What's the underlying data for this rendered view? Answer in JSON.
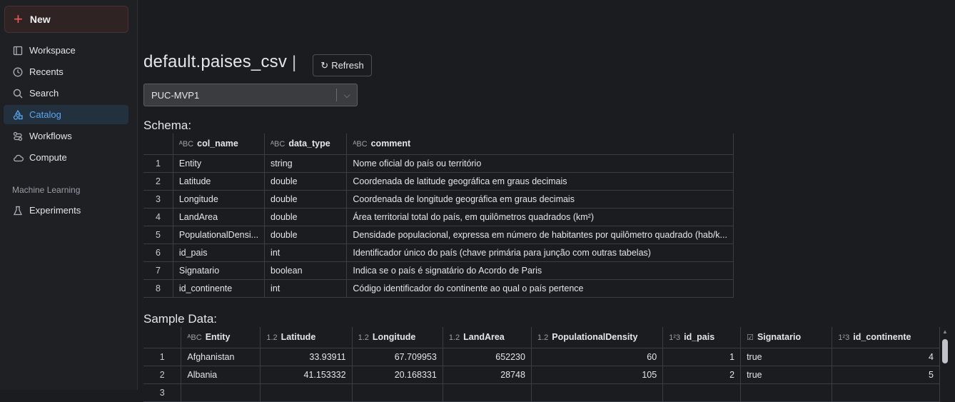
{
  "sidebar": {
    "new_label": "New",
    "items": [
      {
        "label": "Workspace",
        "icon": "workspace-icon"
      },
      {
        "label": "Recents",
        "icon": "clock-icon"
      },
      {
        "label": "Search",
        "icon": "search-icon"
      },
      {
        "label": "Catalog",
        "icon": "catalog-icon",
        "active": true
      },
      {
        "label": "Workflows",
        "icon": "workflows-icon"
      },
      {
        "label": "Compute",
        "icon": "cloud-icon"
      }
    ],
    "ml_section": "Machine Learning",
    "ml_items": [
      {
        "label": "Experiments",
        "icon": "flask-icon"
      }
    ]
  },
  "main": {
    "title": "default.paises_csv",
    "separator": "|",
    "refresh_label": "Refresh",
    "select_value": "PUC-MVP1",
    "schema_title": "Schema:",
    "schema_columns": [
      "col_name",
      "data_type",
      "comment"
    ],
    "schema_rows": [
      [
        "1",
        "Entity",
        "string",
        "Nome oficial do país ou território"
      ],
      [
        "2",
        "Latitude",
        "double",
        "Coordenada de latitude geográfica em graus decimais"
      ],
      [
        "3",
        "Longitude",
        "double",
        "Coordenada de longitude geográfica em graus decimais"
      ],
      [
        "4",
        "LandArea",
        "double",
        "Área territorial total do país, em quilômetros quadrados (km²)"
      ],
      [
        "5",
        "PopulationalDensi...",
        "double",
        "Densidade populacional, expressa em número de habitantes por quilômetro quadrado (hab/k..."
      ],
      [
        "6",
        "id_pais",
        "int",
        "Identificador único do país (chave primária para junção com outras tabelas)"
      ],
      [
        "7",
        "Signatario",
        "boolean",
        "Indica se o país é signatário do Acordo de Paris"
      ],
      [
        "8",
        "id_continente",
        "int",
        "Código identificador do continente ao qual o país pertence"
      ]
    ],
    "sample_title": "Sample Data:",
    "sample_columns": [
      {
        "type": "ABC",
        "name": "Entity"
      },
      {
        "type": "1.2",
        "name": "Latitude"
      },
      {
        "type": "1.2",
        "name": "Longitude"
      },
      {
        "type": "1.2",
        "name": "LandArea"
      },
      {
        "type": "1.2",
        "name": "PopulationalDensity"
      },
      {
        "type": "123",
        "name": "id_pais"
      },
      {
        "type": "check",
        "name": "Signatario"
      },
      {
        "type": "123",
        "name": "id_continente"
      }
    ],
    "sample_rows": [
      [
        "1",
        "Afghanistan",
        "33.93911",
        "67.709953",
        "652230",
        "60",
        "1",
        "true",
        "4"
      ],
      [
        "2",
        "Albania",
        "41.153332",
        "20.168331",
        "28748",
        "105",
        "2",
        "true",
        "5"
      ],
      [
        "3",
        "",
        "",
        "",
        "",
        "",
        "",
        "",
        ""
      ]
    ]
  },
  "colors": {
    "accent": "#5aa7f2",
    "new_plus": "#f05a5a",
    "background": "#1a1c20"
  }
}
